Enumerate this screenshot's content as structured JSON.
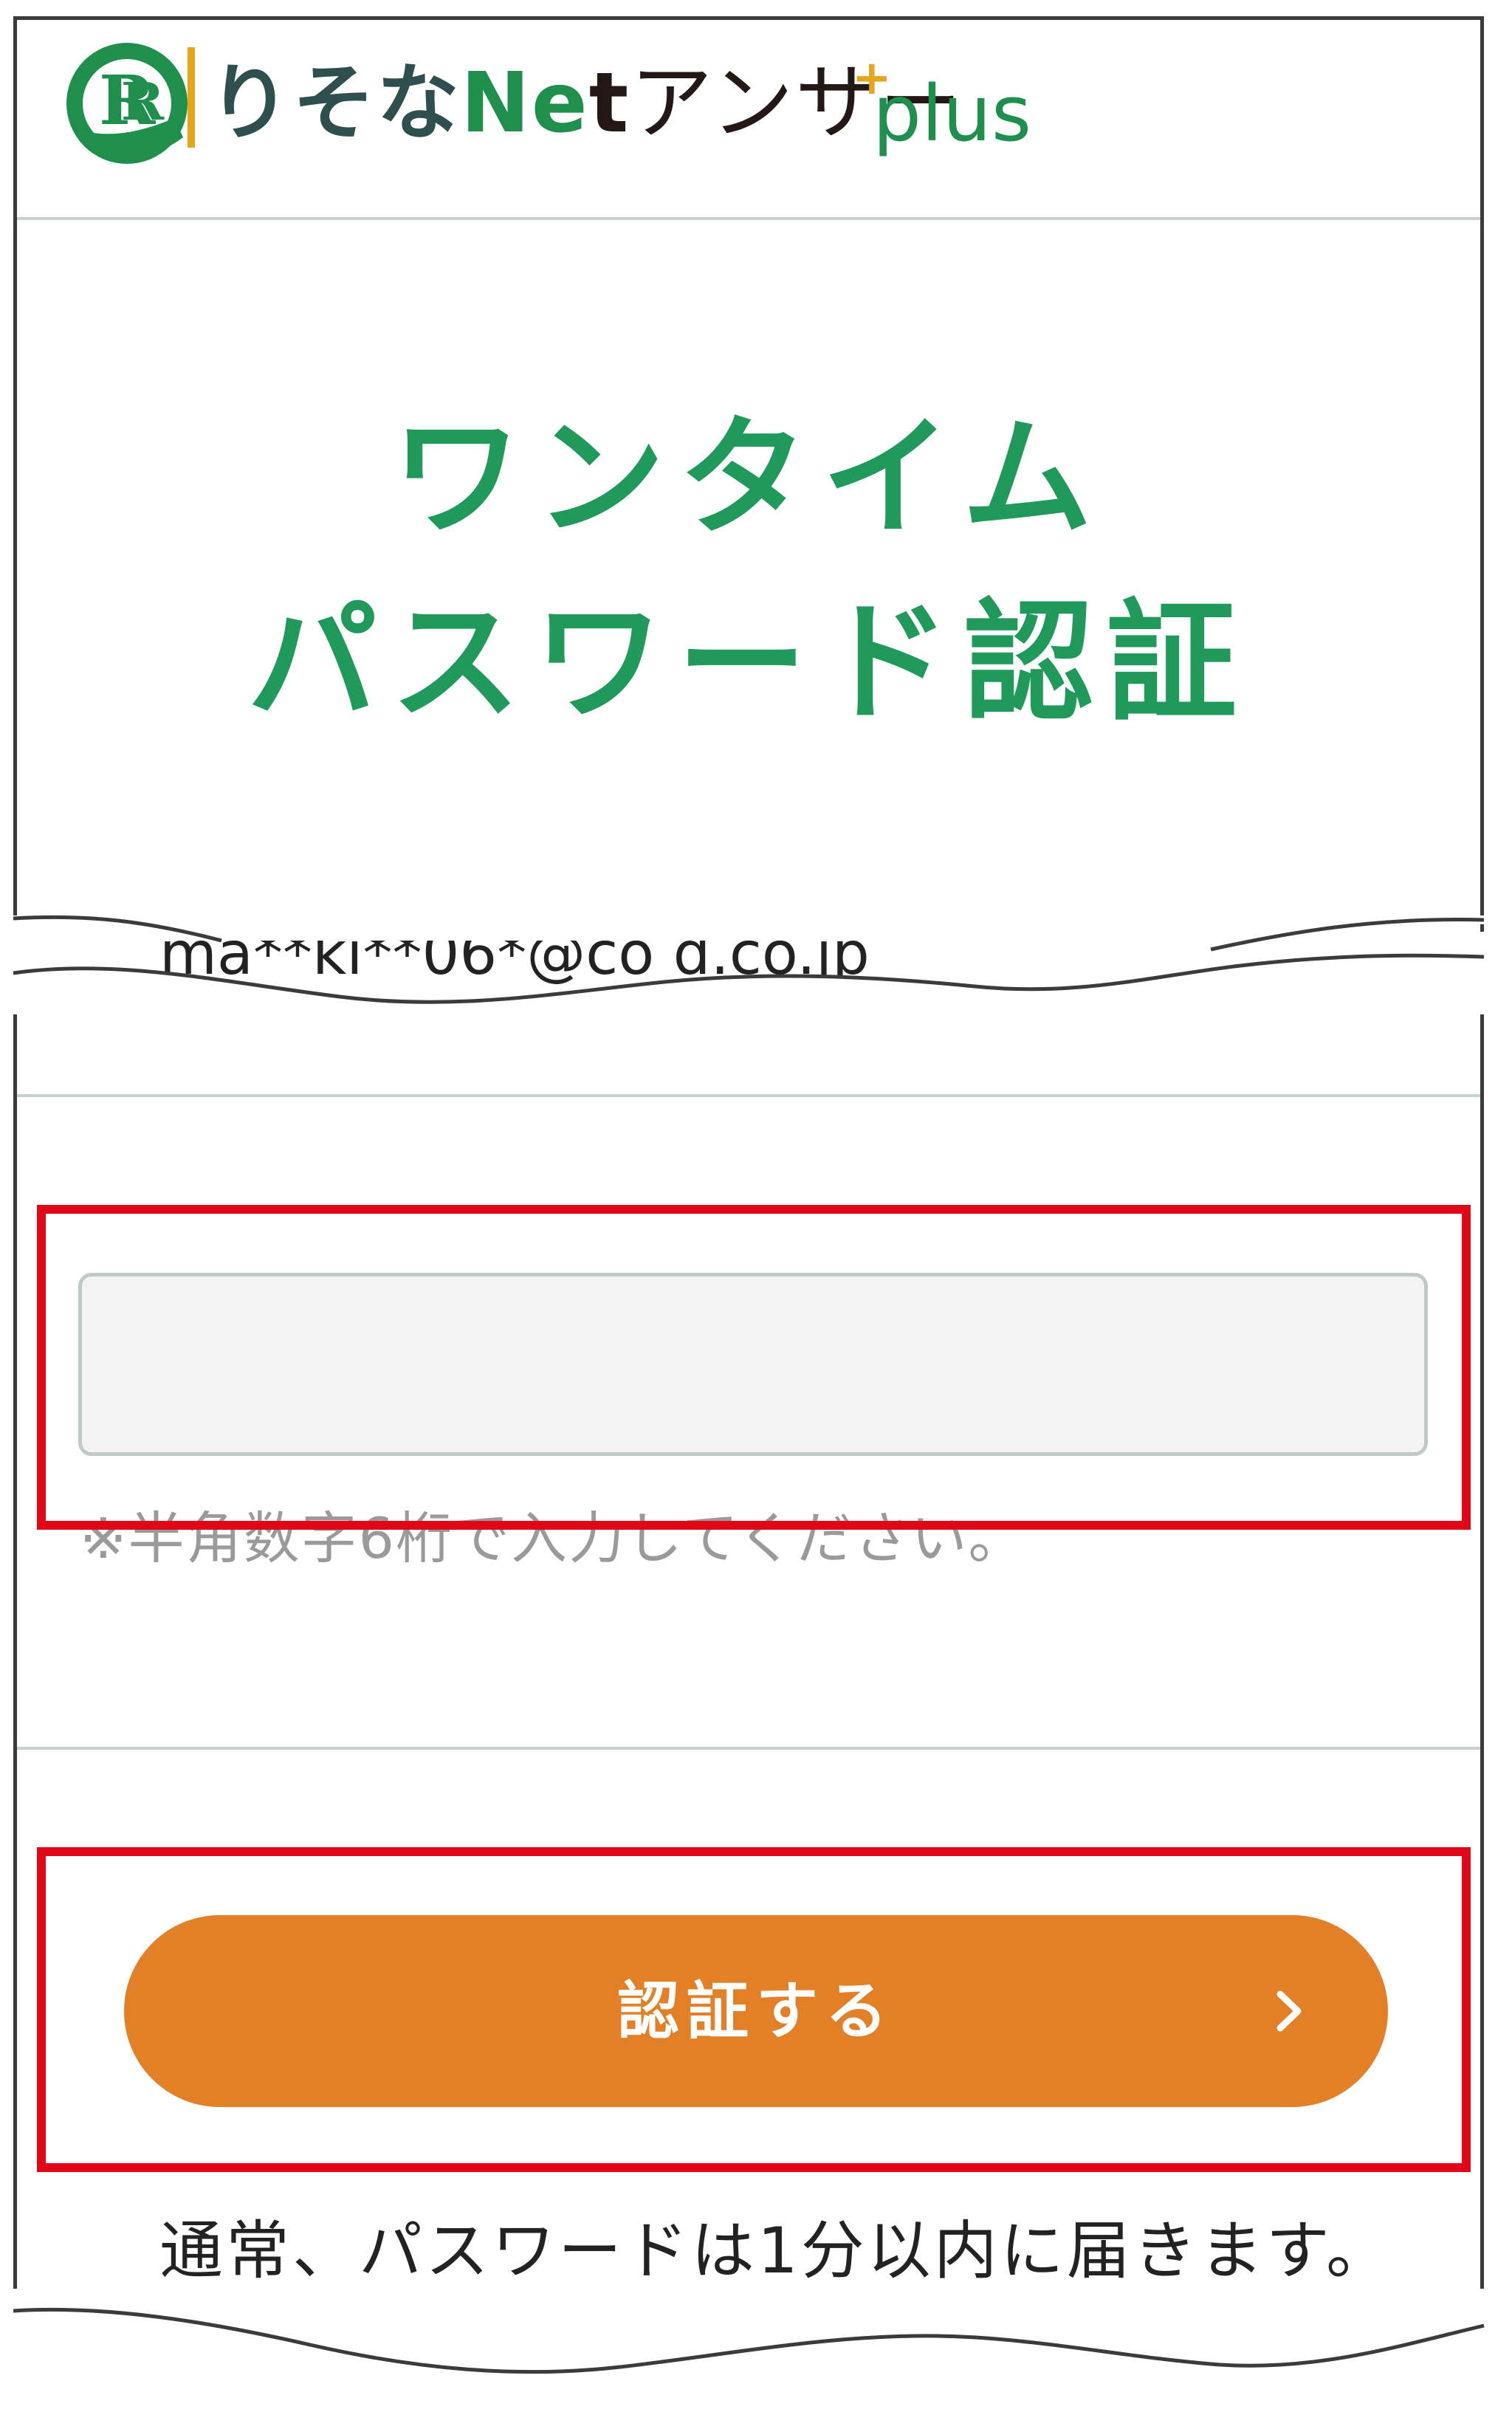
{
  "header": {
    "brand_risona": "りそな",
    "brand_net_n": "Ne",
    "brand_net_t": "t",
    "brand_answer": "アンサー",
    "brand_plus_mark": "+",
    "brand_plus": "plus",
    "logo_icon": "risona-logo-icon"
  },
  "page": {
    "title_line1": "ワンタイム",
    "title_line2": "パスワード認証"
  },
  "email_display": "ma**ki**06*@co                          d.co.jp",
  "otp": {
    "value": "",
    "placeholder": "",
    "hint": "※半角数字6桁で入力してください。"
  },
  "submit": {
    "label": "認証する",
    "icon": "chevron-right-icon"
  },
  "note": "通常、パスワードは1分以内に届きます。",
  "colors": {
    "brand_green": "#1f9a5a",
    "button_orange": "#e27f27",
    "highlight_red": "#e10718",
    "accent_yellow": "#e7a51c"
  }
}
